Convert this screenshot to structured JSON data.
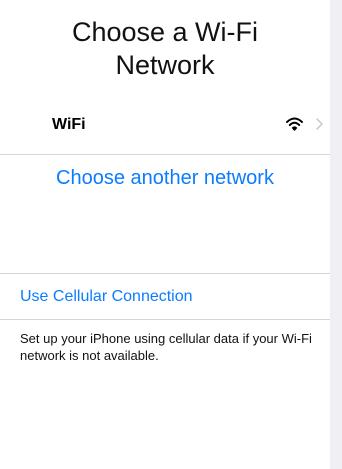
{
  "title_line1": "Choose a Wi-Fi",
  "title_line2": "Network",
  "networks": [
    {
      "name": "WiFi",
      "icon": "wifi-icon"
    }
  ],
  "choose_another": "Choose another network",
  "cellular": {
    "link": "Use Cellular Connection",
    "description": "Set up your iPhone using cellular data if your Wi-Fi network is not available."
  },
  "colors": {
    "accent": "#0b7cff",
    "background": "#efeff4",
    "separator": "#d6d6da"
  }
}
